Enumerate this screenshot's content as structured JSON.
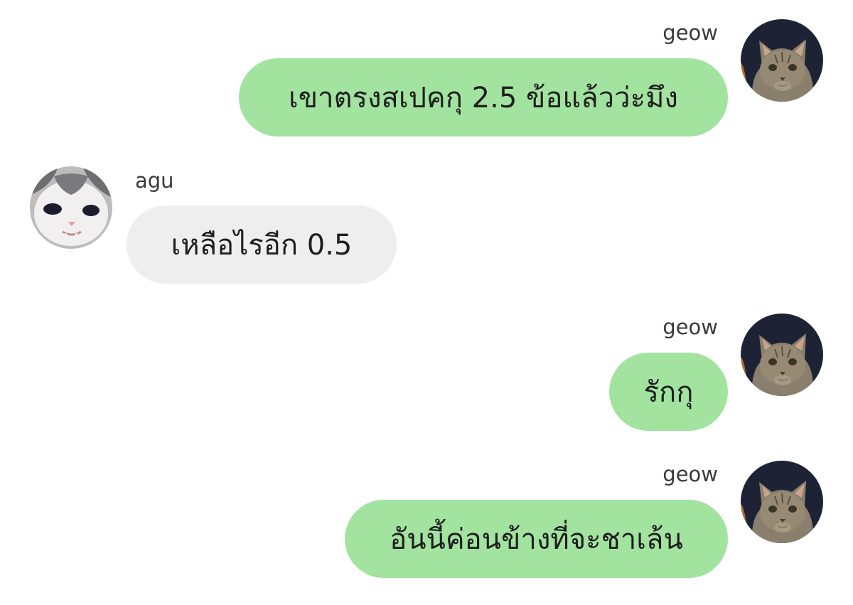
{
  "chat": {
    "messages": [
      {
        "sender": "geow",
        "side": "right",
        "text": "เขาตรงสเปคกุ 2.5 ข้อแล้วว่ะมึง",
        "avatar_icon": "tabby-kitten-avatar-icon"
      },
      {
        "sender": "agu",
        "side": "left",
        "text": "เหลือไรอีก 0.5",
        "avatar_icon": "white-gray-kitten-avatar-icon"
      },
      {
        "sender": "geow",
        "side": "right",
        "text": "รักกุ",
        "avatar_icon": "tabby-kitten-avatar-icon"
      },
      {
        "sender": "geow",
        "side": "right",
        "text": "อันนี้ค่อนข้างที่จะชาเล้น",
        "avatar_icon": "tabby-kitten-avatar-icon"
      }
    ]
  },
  "colors": {
    "outgoing_bubble": "#a2e3a0",
    "incoming_bubble": "#eeeeee",
    "background": "#ffffff"
  }
}
